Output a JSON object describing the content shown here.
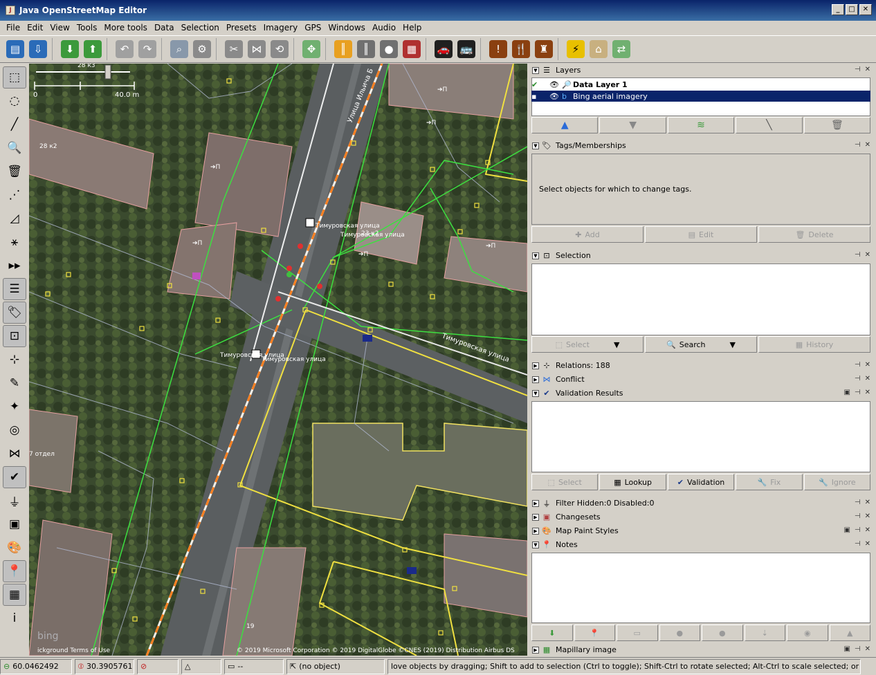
{
  "window": {
    "title": "Java OpenStreetMap Editor",
    "buttons": [
      "_",
      "□",
      "✕"
    ]
  },
  "menu": [
    "File",
    "Edit",
    "View",
    "Tools",
    "More tools",
    "Data",
    "Selection",
    "Presets",
    "Imagery",
    "GPS",
    "Windows",
    "Audio",
    "Help"
  ],
  "toolbar_icons": [
    {
      "name": "open-file-icon",
      "color": "#2a6bb8",
      "glyph": "▤"
    },
    {
      "name": "save-file-icon",
      "color": "#2a6bb8",
      "glyph": "⇩"
    },
    {
      "name": "download-icon",
      "color": "#3c9a3c",
      "glyph": "⬇"
    },
    {
      "name": "upload-icon",
      "color": "#3c9a3c",
      "glyph": "⬆"
    },
    {
      "name": "undo-icon",
      "color": "#a0a0a0",
      "glyph": "↶"
    },
    {
      "name": "redo-icon",
      "color": "#a0a0a0",
      "glyph": "↷"
    },
    {
      "name": "zoom-to-data-icon",
      "color": "#8898aa",
      "glyph": "⌕"
    },
    {
      "name": "preferences-icon",
      "color": "#8a8a8a",
      "glyph": "⚙"
    },
    {
      "name": "split-way-icon",
      "color": "#8a8a8a",
      "glyph": "✂"
    },
    {
      "name": "combine-way-icon",
      "color": "#8a8a8a",
      "glyph": "⋈"
    },
    {
      "name": "reverse-way-icon",
      "color": "#8a8a8a",
      "glyph": "⟲"
    },
    {
      "name": "node-presets-icon",
      "color": "#70b070",
      "glyph": "✥"
    },
    {
      "name": "highway-preset-icon",
      "color": "#e8a020",
      "glyph": "║"
    },
    {
      "name": "road-preset-icon",
      "color": "#707070",
      "glyph": "║"
    },
    {
      "name": "traffic-signals-icon",
      "color": "#707070",
      "glyph": "●"
    },
    {
      "name": "barrier-wall-icon",
      "color": "#b03030",
      "glyph": "▦"
    },
    {
      "name": "car-icon",
      "color": "#ffffff",
      "glyph": "🚗"
    },
    {
      "name": "bus-icon",
      "color": "#ffffff",
      "glyph": "🚌"
    },
    {
      "name": "warning-preset-icon",
      "color": "#8a4010",
      "glyph": "!"
    },
    {
      "name": "restaurant-preset-icon",
      "color": "#8a4010",
      "glyph": "🍴"
    },
    {
      "name": "castle-preset-icon",
      "color": "#8a4010",
      "glyph": "♜"
    },
    {
      "name": "power-preset-icon",
      "color": "#e8c000",
      "glyph": "⚡"
    },
    {
      "name": "industrial-preset-icon",
      "color": "#c8b080",
      "glyph": "⌂"
    },
    {
      "name": "landuse-preset-icon",
      "color": "#70b070",
      "glyph": "⇄"
    }
  ],
  "left_tools": [
    {
      "name": "select-tool-icon",
      "glyph": "⬚",
      "active": true
    },
    {
      "name": "lasso-tool-icon",
      "glyph": "◌",
      "active": false
    },
    {
      "name": "draw-tool-icon",
      "glyph": "╱",
      "active": false
    },
    {
      "name": "zoom-tool-icon",
      "glyph": "🔍",
      "active": false
    },
    {
      "name": "delete-tool-icon",
      "glyph": "🗑",
      "active": false
    },
    {
      "name": "improve-way-tool-icon",
      "glyph": "⋰",
      "active": false
    },
    {
      "name": "parallel-tool-icon",
      "glyph": "◿",
      "active": false
    },
    {
      "name": "extrude-tool-icon",
      "glyph": "⚹",
      "active": false
    },
    {
      "name": "more-tools-icon",
      "glyph": "▸▸",
      "active": false
    },
    {
      "name": "layers-toggle-icon",
      "glyph": "☰",
      "active": true
    },
    {
      "name": "tags-toggle-icon",
      "glyph": "🏷",
      "active": true
    },
    {
      "name": "selection-toggle-icon",
      "glyph": "⊡",
      "active": true
    },
    {
      "name": "relations-toggle-icon",
      "glyph": "⊹",
      "active": false
    },
    {
      "name": "history-toggle-icon",
      "glyph": "✎",
      "active": false
    },
    {
      "name": "commands-toggle-icon",
      "glyph": "✦",
      "active": false
    },
    {
      "name": "imagery-toggle-icon",
      "glyph": "◎",
      "active": false
    },
    {
      "name": "conflict-toggle-icon",
      "glyph": "⋈",
      "active": false
    },
    {
      "name": "validation-toggle-icon",
      "glyph": "✔",
      "active": true
    },
    {
      "name": "filter-toggle-icon",
      "glyph": "⏚",
      "active": false
    },
    {
      "name": "changesets-toggle-icon",
      "glyph": "▣",
      "active": false
    },
    {
      "name": "mapstyles-toggle-icon",
      "glyph": "🎨",
      "active": false
    },
    {
      "name": "notes-toggle-icon",
      "glyph": "📍",
      "active": true
    },
    {
      "name": "mapillary-toggle-icon",
      "glyph": "▦",
      "active": true
    },
    {
      "name": "info-toggle-icon",
      "glyph": "i",
      "active": false
    }
  ],
  "map": {
    "scale_top_label": "28 к3",
    "scale_zero": "0",
    "scale_length": "40.0 m",
    "labels": {
      "house_28k2": "28 к2",
      "bus_stop_1": "Тимуровская улица",
      "bus_stop_2": "Тимуровская улица",
      "bus_stop_3": "Тимуровская улица",
      "bus_stop_4": "Тимуровская улица",
      "street_diag": "Тимуровская улица",
      "street_vert": "Улица Ильича Б",
      "house_23k2": "23 к2",
      "otdel": "7 отдел",
      "house_19": "19",
      "entrance": "➔П"
    },
    "bing_logo": "bing",
    "attribution_left": "ickground Terms of Use",
    "attribution_right": "© 2019 Microsoft Corporation © 2019 DigitalGlobe ©CNES (2019) Distribution Airbus DS"
  },
  "layers": {
    "title": "Layers",
    "items": [
      {
        "name": "Data Layer 1",
        "bold": true
      },
      {
        "name": "Bing aerial imagery",
        "bold": false
      }
    ],
    "buttons": [
      "up-arrow-icon",
      "down-arrow-icon",
      "merge-layers-icon",
      "toggle-visibility-icon",
      "delete-layer-icon"
    ]
  },
  "tags": {
    "title": "Tags/Memberships",
    "empty_text": "Select objects for which to change tags.",
    "buttons": [
      "Add",
      "Edit",
      "Delete"
    ]
  },
  "selection": {
    "title": "Selection",
    "buttons": [
      "Select",
      "Search",
      "History"
    ]
  },
  "relations": {
    "title": "Relations: 188"
  },
  "conflict": {
    "title": "Conflict"
  },
  "validation": {
    "title": "Validation Results",
    "buttons": [
      "Select",
      "Lookup",
      "Validation",
      "Fix",
      "Ignore"
    ]
  },
  "filter": {
    "title": "Filter Hidden:0 Disabled:0"
  },
  "changesets": {
    "title": "Changesets"
  },
  "mapstyles": {
    "title": "Map Paint Styles"
  },
  "notes": {
    "title": "Notes"
  },
  "mapillary": {
    "title": "Mapillary image"
  },
  "status": {
    "lat": "60.0462492",
    "lon": "30.3905761",
    "distance": "--",
    "object": "(no object)",
    "help": "love objects by dragging; Shift to add to selection (Ctrl to toggle); Shift-Ctrl to rotate selected; Alt-Ctrl to scale selected; or change selection"
  }
}
